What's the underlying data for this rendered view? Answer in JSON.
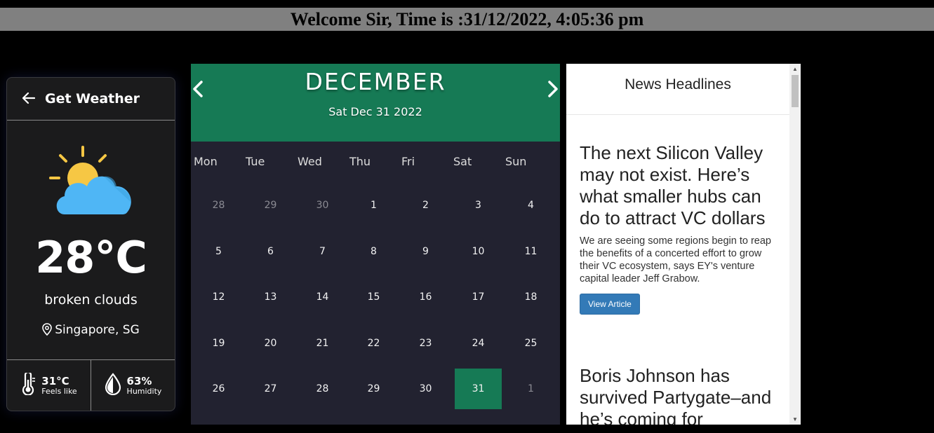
{
  "header": {
    "welcome_text": "Welcome Sir, Time is :31/12/2022, 4:05:36 pm"
  },
  "weather": {
    "title": "Get Weather",
    "back_icon": "arrow-left-icon",
    "temperature": "28°C",
    "description": "broken clouds",
    "location": "Singapore, SG",
    "feels_like_value": "31°C",
    "feels_like_label": "Feels like",
    "humidity_value": "63%",
    "humidity_label": "Humidity",
    "colors": {
      "sun": "#f6c744",
      "cloud": "#4fb6f5",
      "card": "#1b1b1c"
    }
  },
  "calendar": {
    "month": "DECEMBER",
    "date": "Sat Dec 31 2022",
    "prev_icon": "chevron-left-icon",
    "next_icon": "chevron-right-icon",
    "weekdays": [
      "Mon",
      "Tue",
      "Wed",
      "Thu",
      "Fri",
      "Sat",
      "Sun"
    ],
    "weeks": [
      [
        "28",
        "29",
        "30",
        "1",
        "2",
        "3",
        "4"
      ],
      [
        "5",
        "6",
        "7",
        "8",
        "9",
        "10",
        "11"
      ],
      [
        "12",
        "13",
        "14",
        "15",
        "16",
        "17",
        "18"
      ],
      [
        "19",
        "20",
        "21",
        "22",
        "23",
        "24",
        "25"
      ],
      [
        "26",
        "27",
        "28",
        "29",
        "30",
        "31",
        "1"
      ]
    ],
    "accent": "#167a55"
  },
  "news": {
    "title": "News Headlines",
    "articles": [
      {
        "headline": "The next Silicon Valley may not exist. Here’s what smaller hubs can do to attract VC dollars",
        "summary": "We are seeing some regions begin to reap the benefits of a concerted effort to grow their VC ecosystem, says EY's venture capital leader Jeff Grabow.",
        "button": "View Article"
      },
      {
        "headline": "Boris Johnson has survived Partygate–and he’s coming for"
      }
    ],
    "button_color": "#337ab7"
  }
}
